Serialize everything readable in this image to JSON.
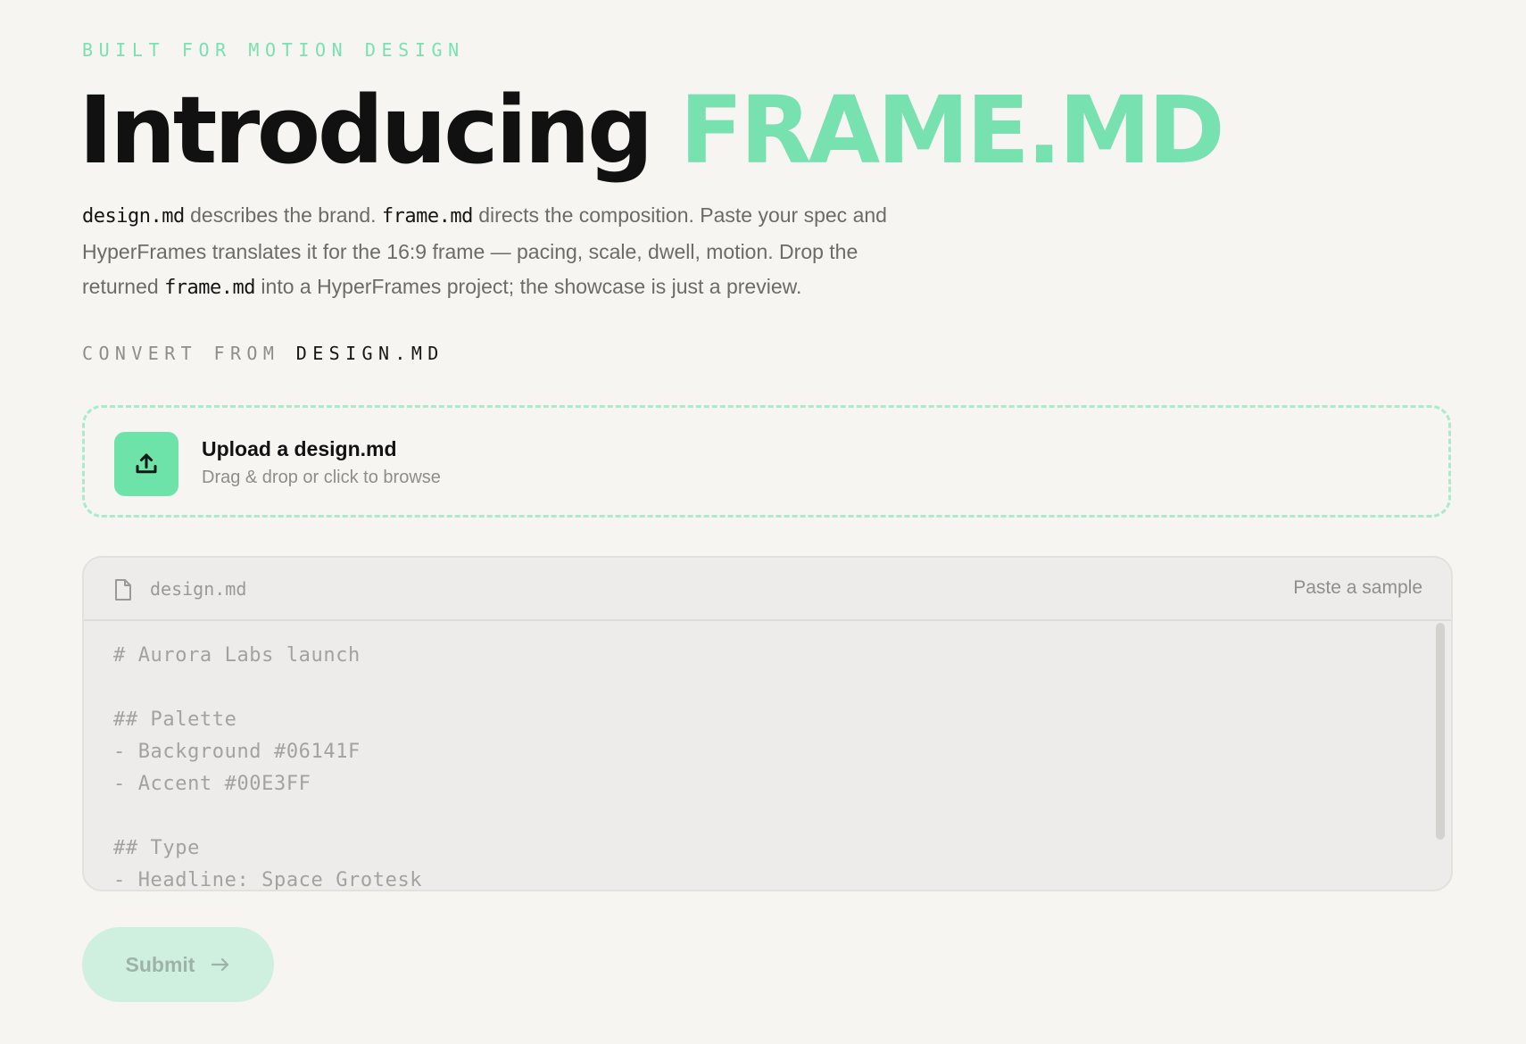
{
  "hero": {
    "eyebrow": "BUILT FOR MOTION DESIGN",
    "headline_prefix": "Introducing",
    "headline_accent": "FRAME.MD",
    "description": {
      "code_design": "design.md",
      "text_1": " describes the brand. ",
      "code_frame_1": "frame.md",
      "text_2": " directs the composition. Paste your spec and HyperFrames translates it for the 16:9 frame — pacing, scale, dwell, motion. Drop the returned ",
      "code_frame_2": "frame.md",
      "text_3": " into a HyperFrames project; the showcase is just a preview."
    }
  },
  "convert": {
    "label_prefix": "CONVERT FROM",
    "label_source": "DESIGN.MD"
  },
  "upload": {
    "title": "Upload a design.md",
    "subtitle": "Drag & drop or click to browse",
    "icon": "upload-icon"
  },
  "editor": {
    "file_name": "design.md",
    "file_icon": "document-icon",
    "paste_sample_label": "Paste a sample",
    "content": "# Aurora Labs launch\n\n## Palette\n- Background #06141F\n- Accent #00E3FF\n\n## Type\n- Headline: Space Grotesk"
  },
  "submit": {
    "label": "Submit",
    "icon": "arrow-right-icon"
  },
  "colors": {
    "accent": "#77e2b0",
    "background": "#f6f5f1",
    "text": "#111111",
    "muted_text": "#6b6b68"
  }
}
